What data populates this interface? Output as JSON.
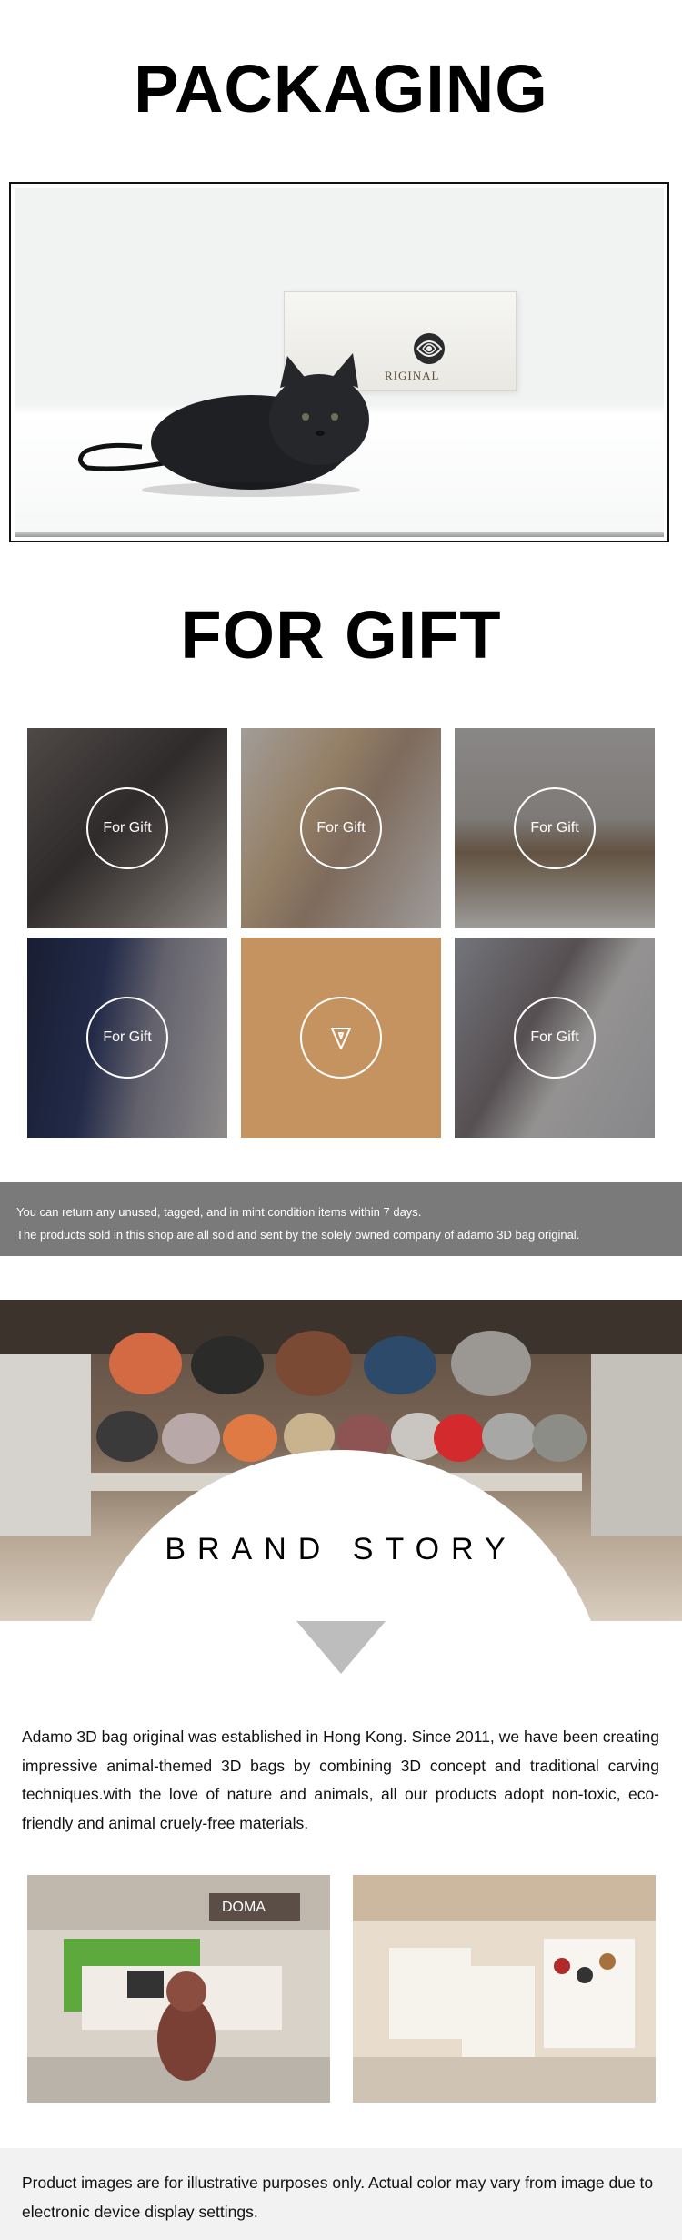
{
  "packaging": {
    "title": "PACKAGING",
    "box_text": "RIGINAL"
  },
  "gift": {
    "title": "FOR GIFT",
    "tiles": [
      {
        "label": "For Gift"
      },
      {
        "label": "For Gift"
      },
      {
        "label": "For Gift"
      },
      {
        "label": "For Gift"
      },
      {
        "label": ""
      },
      {
        "label": "For Gift"
      }
    ],
    "accent_color": "#c4935f"
  },
  "notice": {
    "line1": "You can return any unused, tagged, and in mint condition items within 7 days.",
    "line2": "The products sold in this shop are all sold and sent by the solely owned company of adamo 3D bag original."
  },
  "brand": {
    "title": "BRAND STORY",
    "story": "Adamo 3D bag original was established in Hong Kong. Since 2011, we have been creating impressive animal-themed 3D bags by combining 3D concept and traditional carving techniques.with the love of nature and animals, all our products adopt non-toxic, eco-friendly and animal cruely-free materials."
  },
  "stores": {
    "store1_sign": "DOMA"
  },
  "disclaimer": {
    "text": "Product images are for illustrative purposes only. Actual color may vary from image due to electronic device display settings."
  }
}
